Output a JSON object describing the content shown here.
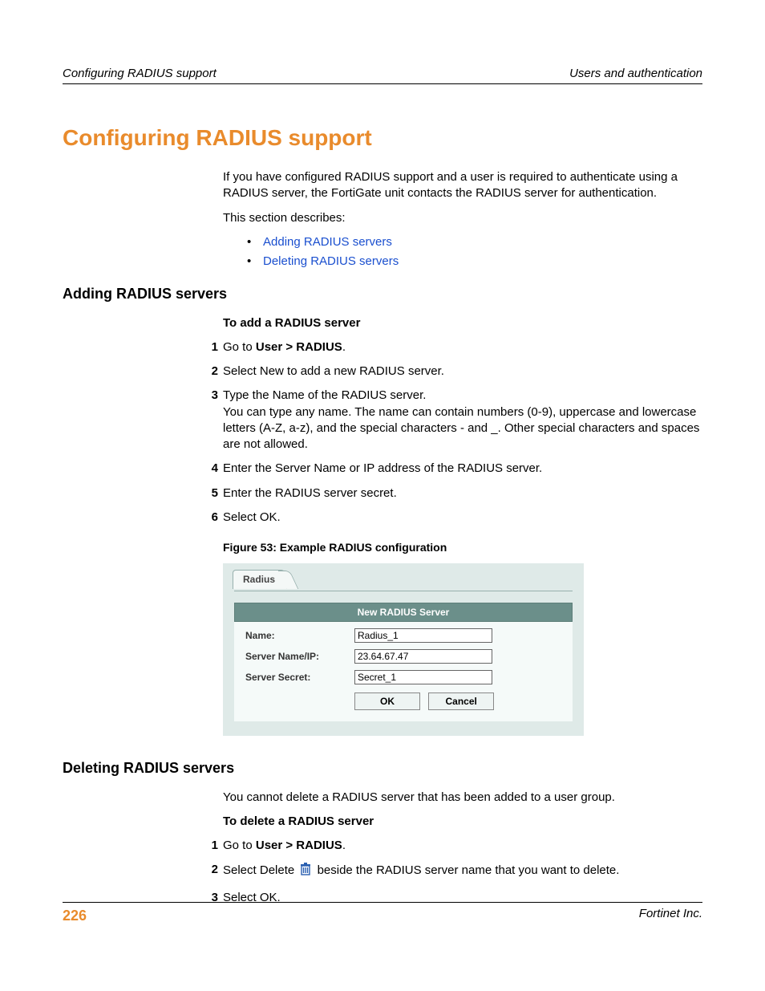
{
  "runhead": {
    "left": "Configuring RADIUS support",
    "right": "Users and authentication"
  },
  "title": "Configuring RADIUS support",
  "intro1": "If you have configured RADIUS support and a user is required to authenticate using a RADIUS server, the FortiGate unit contacts the RADIUS server for authentication.",
  "intro2": "This section describes:",
  "bullets": {
    "b1": "Adding RADIUS servers",
    "b2": "Deleting RADIUS servers"
  },
  "adding": {
    "heading": "Adding RADIUS servers",
    "procTitle": "To add a RADIUS server",
    "s1a": "Go to ",
    "s1b": "User > RADIUS",
    "s1c": ".",
    "s2": "Select New to add a new RADIUS server.",
    "s3a": "Type the Name of the RADIUS server.",
    "s3b": "You can type any name. The name can contain numbers (0-9), uppercase and lowercase letters (A-Z, a-z), and the special characters - and _. Other special characters and spaces are not allowed.",
    "s4": "Enter the Server Name or IP address of the RADIUS server.",
    "s5": "Enter the RADIUS server secret.",
    "s6": "Select OK."
  },
  "figure": {
    "caption": "Figure 53: Example RADIUS configuration",
    "tab": "Radius",
    "panelTitle": "New RADIUS Server",
    "nameLabel": "Name:",
    "nameValue": "Radius_1",
    "serverLabel": "Server Name/IP:",
    "serverValue": "23.64.67.47",
    "secretLabel": "Server Secret:",
    "secretValue": "Secret_1",
    "ok": "OK",
    "cancel": "Cancel"
  },
  "deleting": {
    "heading": "Deleting RADIUS servers",
    "intro": "You cannot delete a RADIUS server that has been added to a user group.",
    "procTitle": "To delete a RADIUS server",
    "s1a": "Go to ",
    "s1b": "User > RADIUS",
    "s1c": ".",
    "s2a": "Select Delete ",
    "s2b": " beside the RADIUS server name that you want to delete.",
    "s3": "Select OK."
  },
  "foot": {
    "page": "226",
    "company": "Fortinet Inc."
  }
}
